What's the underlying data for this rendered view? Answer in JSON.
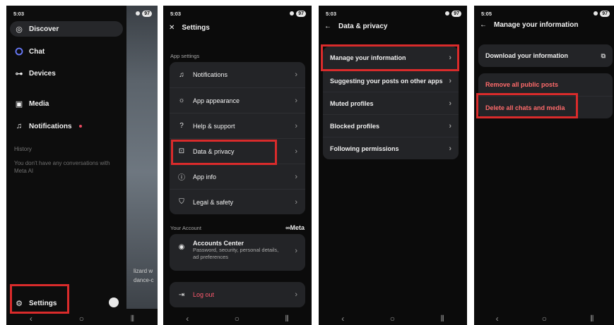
{
  "status_bars": {
    "p1": {
      "time": "5:03",
      "battery": "97"
    },
    "p2": {
      "time": "5:03",
      "battery": "97"
    },
    "p3": {
      "time": "5:03",
      "battery": "97"
    },
    "p4": {
      "time": "5:05",
      "battery": "97"
    }
  },
  "highlight_color": "#d92b2b",
  "panel1": {
    "menu": [
      {
        "label": "Discover",
        "icon": "compass-icon"
      },
      {
        "label": "Chat",
        "icon": "meta-ai-ring-icon"
      },
      {
        "label": "Devices",
        "icon": "glasses-icon"
      },
      {
        "label": "Media",
        "icon": "image-icon"
      },
      {
        "label": "Notifications",
        "icon": "bell-icon"
      }
    ],
    "history_label": "History",
    "history_empty": "You don't have any conversations with Meta AI",
    "side_text_1": "lizard w",
    "side_text_2": "dance-c",
    "settings_label": "Settings"
  },
  "panel2": {
    "title": "Settings",
    "app_settings_label": "App settings",
    "app_settings": [
      {
        "label": "Notifications",
        "icon": "bell-icon"
      },
      {
        "label": "App appearance",
        "icon": "sun-icon"
      },
      {
        "label": "Help & support",
        "icon": "question-icon"
      },
      {
        "label": "Data & privacy",
        "icon": "lock-icon"
      },
      {
        "label": "App info",
        "icon": "info-icon"
      },
      {
        "label": "Legal & safety",
        "icon": "shield-icon"
      }
    ],
    "your_account_label": "Your Account",
    "meta_logo": "∞Meta",
    "accounts_center_title": "Accounts Center",
    "accounts_center_sub": "Password, security, personal details, ad preferences",
    "logout_label": "Log out"
  },
  "panel3": {
    "title": "Data & privacy",
    "items": [
      "Manage your information",
      "Suggesting your posts on other apps",
      "Muted profiles",
      "Blocked profiles",
      "Following permissions"
    ]
  },
  "panel4": {
    "title": "Manage your information",
    "download_label": "Download your information",
    "remove_posts_label": "Remove all public posts",
    "delete_chats_label": "Delete all chats and media"
  }
}
